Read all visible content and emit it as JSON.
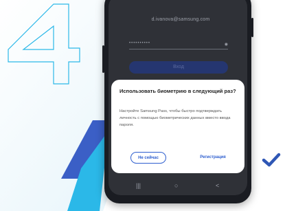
{
  "step_number": "4",
  "colors": {
    "stripe_dark": "#3b5fc6",
    "stripe_light": "#2bb8e8",
    "accent": "#2d5ecf",
    "check": "#2f57b5"
  },
  "login_form": {
    "email": "d.ivanova@samsung.com",
    "password_mask": "••••••••••",
    "show_password_icon": "eye-icon",
    "login_button_label": "Вход"
  },
  "dialog": {
    "title": "Использовать биометрию в следующий раз?",
    "body": "Настройте Samsung Pass, чтобы быстро подтверждать личность с помощью биометрических данных вместо ввода пароля.",
    "secondary_button": "Не сейчас",
    "primary_button": "Регистрация"
  },
  "nav_bar": {
    "recents_icon": "|||",
    "home_icon": "○",
    "back_icon": "<"
  },
  "check_icon": "checkmark-icon"
}
